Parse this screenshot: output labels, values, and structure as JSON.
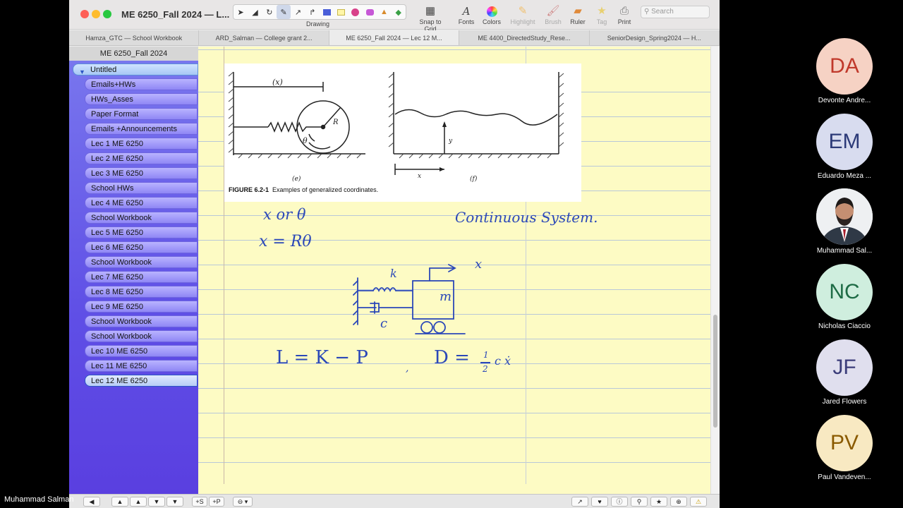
{
  "window": {
    "title": "ME 6250_Fall 2024 — L...",
    "drawing_label": "Drawing",
    "toolbar": [
      {
        "label": "Snap to Grid",
        "icon": "grid-icon",
        "dim": false
      },
      {
        "label": "Fonts",
        "icon": "font-icon",
        "dim": false
      },
      {
        "label": "Colors",
        "icon": "color-wheel-icon",
        "dim": false
      },
      {
        "label": "Highlight",
        "icon": "highlighter-icon",
        "dim": true
      },
      {
        "label": "Brush",
        "icon": "brush-icon",
        "dim": true
      },
      {
        "label": "Ruler",
        "icon": "ruler-icon",
        "dim": false
      },
      {
        "label": "Tag",
        "icon": "star-tag-icon",
        "dim": true
      },
      {
        "label": "Print",
        "icon": "printer-icon",
        "dim": false
      }
    ],
    "search_placeholder": "Search"
  },
  "tabs": [
    {
      "label": "Hamza_GTC — School Workbook",
      "active": false
    },
    {
      "label": "ARD_Salman — College grant 2...",
      "active": false
    },
    {
      "label": "ME 6250_Fall 2024 — Lec 12 M...",
      "active": true
    },
    {
      "label": "ME 4400_DirectedStudy_Rese...",
      "active": false
    },
    {
      "label": "SeniorDesign_Spring2024 — H...",
      "active": false
    }
  ],
  "sidebar": {
    "header": "ME 6250_Fall 2024",
    "items": [
      {
        "label": "Untitled"
      },
      {
        "label": "Emails+HWs"
      },
      {
        "label": "HWs_Asses"
      },
      {
        "label": "Paper Format"
      },
      {
        "label": "Emails +Announcements"
      },
      {
        "label": "Lec 1 ME 6250"
      },
      {
        "label": "Lec 2 ME 6250"
      },
      {
        "label": "Lec 3 ME 6250"
      },
      {
        "label": "School HWs"
      },
      {
        "label": "Lec 4 ME 6250"
      },
      {
        "label": "School Workbook"
      },
      {
        "label": "Lec 5 ME 6250"
      },
      {
        "label": "Lec 6 ME 6250"
      },
      {
        "label": "School Workbook"
      },
      {
        "label": "Lec 7 ME 6250"
      },
      {
        "label": "Lec 8 ME 6250"
      },
      {
        "label": "Lec 9 ME 6250"
      },
      {
        "label": "School Workbook"
      },
      {
        "label": "School Workbook"
      },
      {
        "label": "Lec 10 ME 6250"
      },
      {
        "label": "Lec 11 ME 6250"
      },
      {
        "label": "Lec 12 ME 6250"
      }
    ],
    "selected": "Lec 12 ME 6250"
  },
  "footer": {
    "buttons": [
      "◀",
      "▲",
      "▲",
      "▼",
      "▼",
      "+S",
      "+P",
      "⊖ ▾"
    ],
    "right_icons": [
      "pen-icon",
      "heart-icon",
      "info-icon",
      "magnifier-icon",
      "star-icon",
      "plus-circle-icon",
      "warning-icon"
    ]
  },
  "page": {
    "figure": {
      "caption_label": "FIGURE 6.2-1",
      "caption_text": "Examples of generalized coordinates.",
      "panel_e": "(e)",
      "panel_f": "(f)",
      "labels": {
        "x_top": "(x)",
        "R": "R",
        "theta": "θ",
        "y": "y",
        "x_bottom": "x"
      }
    },
    "handwriting": {
      "line1": "x  or  θ",
      "line2": "x = Rθ",
      "continuous": "Continuous System.",
      "k": "k",
      "x_arrow": "x",
      "m": "m",
      "c": "c",
      "lagrangian": "L = K − P",
      "comma": ",",
      "dissipation": "D = ",
      "half_num": "1",
      "half_den": "2",
      "c_tail": "c ẋ"
    }
  },
  "participants": [
    {
      "initials": "DA",
      "name": "Devonte Andre...",
      "bg": "#f6d2c4",
      "fg": "#c0392b"
    },
    {
      "initials": "EM",
      "name": "Eduardo Meza ...",
      "bg": "#d8dcef",
      "fg": "#2c3a78"
    },
    {
      "initials": "",
      "name": "Muhammad Sal...",
      "bg": "#ffffff",
      "fg": "#000000",
      "photo": true
    },
    {
      "initials": "NC",
      "name": "Nicholas Ciaccio",
      "bg": "#cfeede",
      "fg": "#1e6b45"
    },
    {
      "initials": "JF",
      "name": "Jared Flowers",
      "bg": "#e0dfee",
      "fg": "#3b3d7a"
    },
    {
      "initials": "PV",
      "name": "Paul Vandeven...",
      "bg": "#f8e9c2",
      "fg": "#8a5a00"
    }
  ],
  "self_label": "Muhammad Salman"
}
